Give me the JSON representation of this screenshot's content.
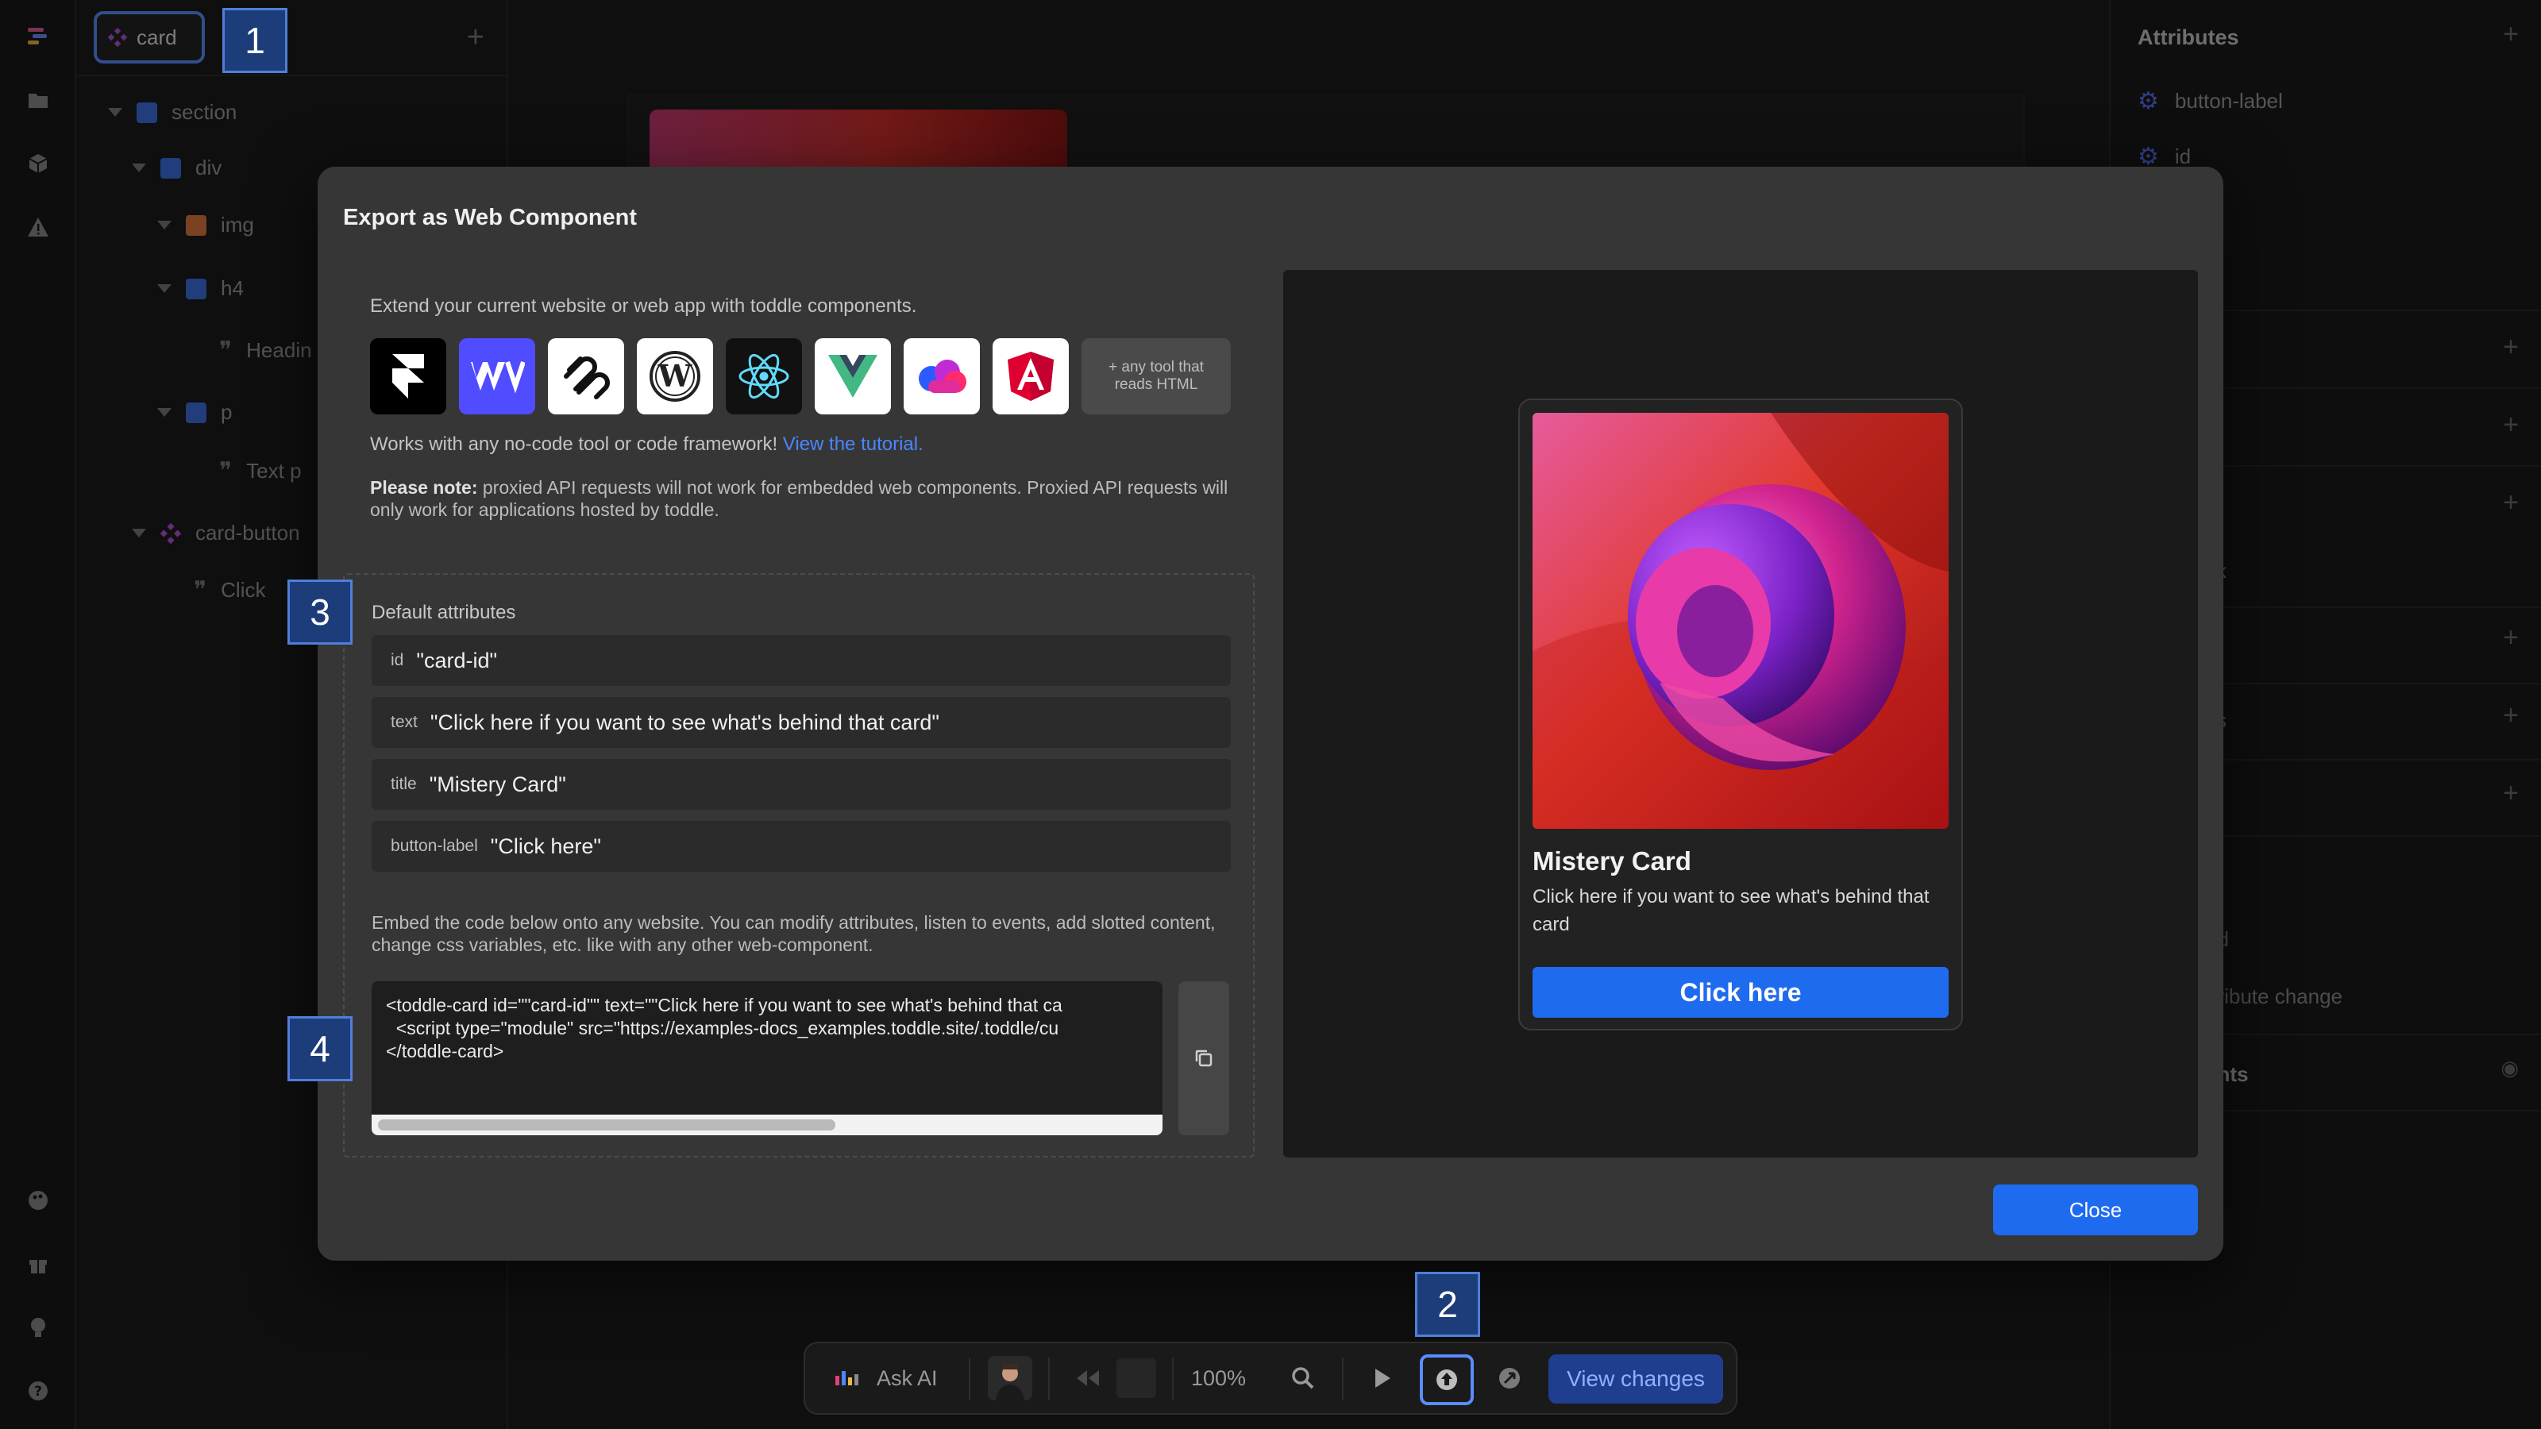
{
  "tree": {
    "component_name": "card",
    "nodes": [
      {
        "label": "section",
        "color": "#3d6fe0"
      },
      {
        "label": "div",
        "color": "#3d6fe0"
      },
      {
        "label": "img",
        "color": "#e0783d"
      },
      {
        "label": "h4",
        "color": "#3d6fe0"
      },
      {
        "label": "Headin"
      },
      {
        "label": "p",
        "color": "#3d6fe0"
      },
      {
        "label": "Text p"
      },
      {
        "label": "card-button",
        "color": "#b455d6"
      },
      {
        "label": "Click"
      }
    ]
  },
  "right_panel": {
    "title": "Attributes",
    "attributes": [
      "button-label",
      "id"
    ],
    "fragments": [
      "s",
      "ck",
      "s",
      "vs",
      "s",
      "ad",
      "ttribute change",
      "ents"
    ]
  },
  "modal": {
    "title": "Export as Web Component",
    "intro": "Extend your current website or web app with toddle components.",
    "logos": [
      {
        "name": "framer-logo",
        "bg": "#000000"
      },
      {
        "name": "webflow-logo",
        "bg": "#4f4dff"
      },
      {
        "name": "squarespace-logo",
        "bg": "#ffffff"
      },
      {
        "name": "wordpress-logo",
        "bg": "#ffffff"
      },
      {
        "name": "react-logo",
        "bg": "#111111"
      },
      {
        "name": "vue-logo",
        "bg": "#ffffff"
      },
      {
        "name": "cloud-logo",
        "bg": "#ffffff"
      },
      {
        "name": "angular-logo",
        "bg": "#ffffff"
      }
    ],
    "any_tool": "+ any tool that reads HTML",
    "works_text": "Works with any no-code tool or code framework!",
    "tutorial_link": "View the tutorial.",
    "note_label": "Please note:",
    "note_text": "proxied API requests will not work for embedded web components. Proxied API requests will only work for applications hosted by toddle.",
    "default_attributes_heading": "Default attributes",
    "attributes": [
      {
        "key": "id",
        "value": "\"card-id\""
      },
      {
        "key": "text",
        "value": "\"Click here if you want to see what's behind that card\""
      },
      {
        "key": "title",
        "value": "\"Mistery Card\""
      },
      {
        "key": "button-label",
        "value": "\"Click here\""
      }
    ],
    "embed_text": "Embed the code below onto any website. You can modify attributes, listen to events, add slotted content, change css variables, etc. like with any other web-component.",
    "code_lines": [
      "<toddle-card id=\"\"card-id\"\" text=\"\"Click here if you want to see what's behind that ca",
      "  <script type=\"module\" src=\"https://examples-docs_examples.toddle.site/.toddle/cu",
      "</toddle-card>"
    ],
    "preview": {
      "card_title": "Mistery Card",
      "card_text": "Click here if you want to see what's behind that card",
      "card_button": "Click here"
    },
    "close_label": "Close"
  },
  "bottombar": {
    "ask_ai": "Ask AI",
    "zoom": "100%",
    "view_changes": "View changes"
  },
  "markers": [
    "1",
    "2",
    "3",
    "4"
  ]
}
